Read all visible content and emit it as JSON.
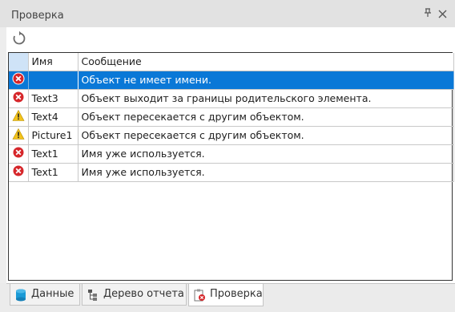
{
  "panel": {
    "title": "Проверка",
    "pin_icon": "pin-icon",
    "close_icon": "close-icon"
  },
  "toolbar": {
    "refresh_icon": "refresh-icon"
  },
  "grid": {
    "columns": {
      "icon": "",
      "name": "Имя",
      "message": "Сообщение"
    },
    "rows": [
      {
        "severity": "error",
        "name": "",
        "message": "Объект не имеет имени.",
        "selected": true
      },
      {
        "severity": "error",
        "name": "Text3",
        "message": "Объект выходит за границы родительского элемента."
      },
      {
        "severity": "warning",
        "name": "Text4",
        "message": "Объект пересекается с другим объектом."
      },
      {
        "severity": "warning",
        "name": "Picture1",
        "message": "Объект пересекается с другим объектом."
      },
      {
        "severity": "error",
        "name": "Text1",
        "message": "Имя уже используется."
      },
      {
        "severity": "error",
        "name": "Text1",
        "message": "Имя уже используется."
      }
    ]
  },
  "tabs": [
    {
      "label": "Данные",
      "icon": "database-icon",
      "active": false
    },
    {
      "label": "Дерево отчета",
      "icon": "tree-icon",
      "active": false
    },
    {
      "label": "Проверка",
      "icon": "check-icon",
      "active": true
    }
  ],
  "colors": {
    "selection": "#0a78d7",
    "error": "#d6262a",
    "warning": "#f2c21b"
  }
}
